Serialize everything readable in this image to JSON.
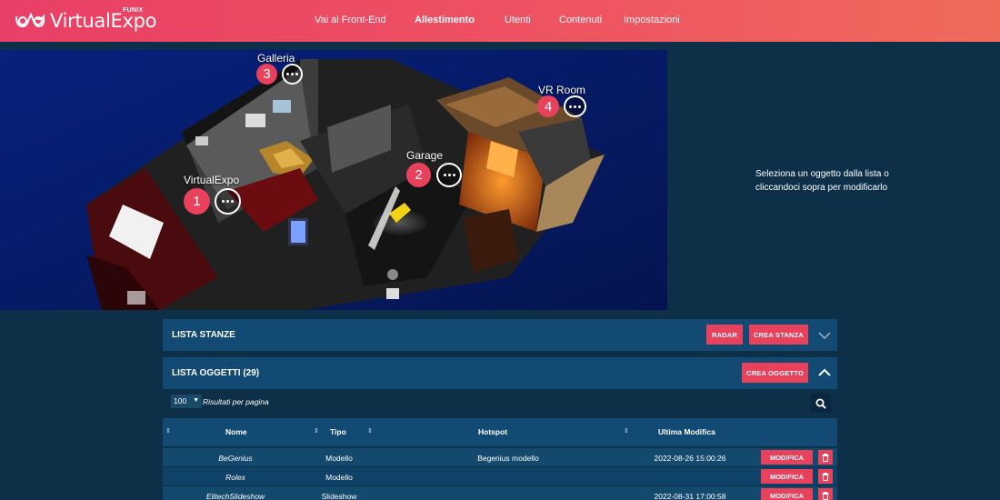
{
  "brand": {
    "name": "VirtualExpo",
    "sup": "FUNIX"
  },
  "nav": [
    {
      "label": "Vai al Front-End"
    },
    {
      "label": "Allestimento"
    },
    {
      "label": "Utenti"
    },
    {
      "label": "Contenuti"
    },
    {
      "label": "Impostazioni"
    }
  ],
  "rooms": [
    {
      "label": "VirtualExpo",
      "number": "1"
    },
    {
      "label": "Garage",
      "number": "2"
    },
    {
      "label": "Galleria",
      "number": "3"
    },
    {
      "label": "VR Room",
      "number": "4"
    }
  ],
  "hint": "Seleziona un oggetto dalla lista o cliccandoci sopra per modificarlo",
  "rooms_panel": {
    "title": "LISTA STANZE",
    "radar": "RADAR",
    "create": "CREA STANZA"
  },
  "objects_panel": {
    "title": "LISTA OGGETTI (29)",
    "create": "CREA OGGETTO"
  },
  "controls": {
    "per_page_value": "100",
    "per_page_label": "Risultati per pagina"
  },
  "table": {
    "headers": {
      "name": "Nome",
      "type": "Tipo",
      "hotspot": "Hotspot",
      "modified": "Ultima Modifica"
    },
    "edit_label": "MODIFICA",
    "rows": [
      {
        "name": "BeGenius",
        "type": "Modello",
        "hotspot": "Begenius modello",
        "modified": "2022-08-26 15:00:26"
      },
      {
        "name": "Rolex",
        "type": "Modello",
        "hotspot": "",
        "modified": ""
      },
      {
        "name": "ElitechSlideshow",
        "type": "Slideshow",
        "hotspot": "",
        "modified": "2022-08-31 17:00:58"
      }
    ]
  },
  "colors": {
    "accent": "#e8415c",
    "background": "#0d3048",
    "panel": "#124a74"
  }
}
